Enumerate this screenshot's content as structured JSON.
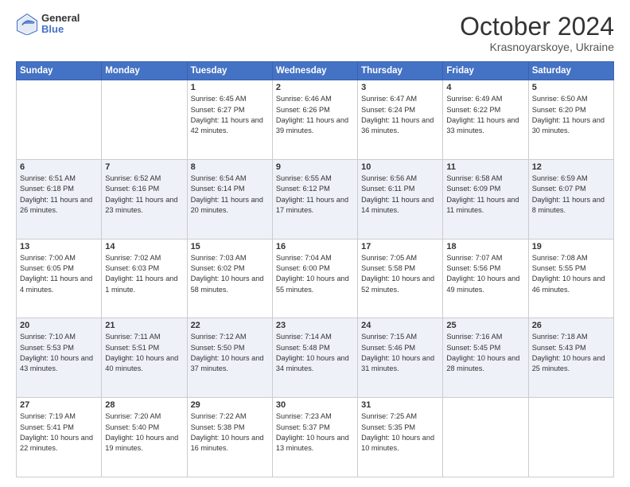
{
  "header": {
    "logo_line1": "General",
    "logo_line2": "Blue",
    "title": "October 2024",
    "subtitle": "Krasnoyarskoye, Ukraine"
  },
  "calendar": {
    "days_of_week": [
      "Sunday",
      "Monday",
      "Tuesday",
      "Wednesday",
      "Thursday",
      "Friday",
      "Saturday"
    ],
    "weeks": [
      [
        {
          "day": "",
          "info": ""
        },
        {
          "day": "",
          "info": ""
        },
        {
          "day": "1",
          "info": "Sunrise: 6:45 AM\nSunset: 6:27 PM\nDaylight: 11 hours and 42 minutes."
        },
        {
          "day": "2",
          "info": "Sunrise: 6:46 AM\nSunset: 6:26 PM\nDaylight: 11 hours and 39 minutes."
        },
        {
          "day": "3",
          "info": "Sunrise: 6:47 AM\nSunset: 6:24 PM\nDaylight: 11 hours and 36 minutes."
        },
        {
          "day": "4",
          "info": "Sunrise: 6:49 AM\nSunset: 6:22 PM\nDaylight: 11 hours and 33 minutes."
        },
        {
          "day": "5",
          "info": "Sunrise: 6:50 AM\nSunset: 6:20 PM\nDaylight: 11 hours and 30 minutes."
        }
      ],
      [
        {
          "day": "6",
          "info": "Sunrise: 6:51 AM\nSunset: 6:18 PM\nDaylight: 11 hours and 26 minutes."
        },
        {
          "day": "7",
          "info": "Sunrise: 6:52 AM\nSunset: 6:16 PM\nDaylight: 11 hours and 23 minutes."
        },
        {
          "day": "8",
          "info": "Sunrise: 6:54 AM\nSunset: 6:14 PM\nDaylight: 11 hours and 20 minutes."
        },
        {
          "day": "9",
          "info": "Sunrise: 6:55 AM\nSunset: 6:12 PM\nDaylight: 11 hours and 17 minutes."
        },
        {
          "day": "10",
          "info": "Sunrise: 6:56 AM\nSunset: 6:11 PM\nDaylight: 11 hours and 14 minutes."
        },
        {
          "day": "11",
          "info": "Sunrise: 6:58 AM\nSunset: 6:09 PM\nDaylight: 11 hours and 11 minutes."
        },
        {
          "day": "12",
          "info": "Sunrise: 6:59 AM\nSunset: 6:07 PM\nDaylight: 11 hours and 8 minutes."
        }
      ],
      [
        {
          "day": "13",
          "info": "Sunrise: 7:00 AM\nSunset: 6:05 PM\nDaylight: 11 hours and 4 minutes."
        },
        {
          "day": "14",
          "info": "Sunrise: 7:02 AM\nSunset: 6:03 PM\nDaylight: 11 hours and 1 minute."
        },
        {
          "day": "15",
          "info": "Sunrise: 7:03 AM\nSunset: 6:02 PM\nDaylight: 10 hours and 58 minutes."
        },
        {
          "day": "16",
          "info": "Sunrise: 7:04 AM\nSunset: 6:00 PM\nDaylight: 10 hours and 55 minutes."
        },
        {
          "day": "17",
          "info": "Sunrise: 7:05 AM\nSunset: 5:58 PM\nDaylight: 10 hours and 52 minutes."
        },
        {
          "day": "18",
          "info": "Sunrise: 7:07 AM\nSunset: 5:56 PM\nDaylight: 10 hours and 49 minutes."
        },
        {
          "day": "19",
          "info": "Sunrise: 7:08 AM\nSunset: 5:55 PM\nDaylight: 10 hours and 46 minutes."
        }
      ],
      [
        {
          "day": "20",
          "info": "Sunrise: 7:10 AM\nSunset: 5:53 PM\nDaylight: 10 hours and 43 minutes."
        },
        {
          "day": "21",
          "info": "Sunrise: 7:11 AM\nSunset: 5:51 PM\nDaylight: 10 hours and 40 minutes."
        },
        {
          "day": "22",
          "info": "Sunrise: 7:12 AM\nSunset: 5:50 PM\nDaylight: 10 hours and 37 minutes."
        },
        {
          "day": "23",
          "info": "Sunrise: 7:14 AM\nSunset: 5:48 PM\nDaylight: 10 hours and 34 minutes."
        },
        {
          "day": "24",
          "info": "Sunrise: 7:15 AM\nSunset: 5:46 PM\nDaylight: 10 hours and 31 minutes."
        },
        {
          "day": "25",
          "info": "Sunrise: 7:16 AM\nSunset: 5:45 PM\nDaylight: 10 hours and 28 minutes."
        },
        {
          "day": "26",
          "info": "Sunrise: 7:18 AM\nSunset: 5:43 PM\nDaylight: 10 hours and 25 minutes."
        }
      ],
      [
        {
          "day": "27",
          "info": "Sunrise: 7:19 AM\nSunset: 5:41 PM\nDaylight: 10 hours and 22 minutes."
        },
        {
          "day": "28",
          "info": "Sunrise: 7:20 AM\nSunset: 5:40 PM\nDaylight: 10 hours and 19 minutes."
        },
        {
          "day": "29",
          "info": "Sunrise: 7:22 AM\nSunset: 5:38 PM\nDaylight: 10 hours and 16 minutes."
        },
        {
          "day": "30",
          "info": "Sunrise: 7:23 AM\nSunset: 5:37 PM\nDaylight: 10 hours and 13 minutes."
        },
        {
          "day": "31",
          "info": "Sunrise: 7:25 AM\nSunset: 5:35 PM\nDaylight: 10 hours and 10 minutes."
        },
        {
          "day": "",
          "info": ""
        },
        {
          "day": "",
          "info": ""
        }
      ]
    ]
  }
}
